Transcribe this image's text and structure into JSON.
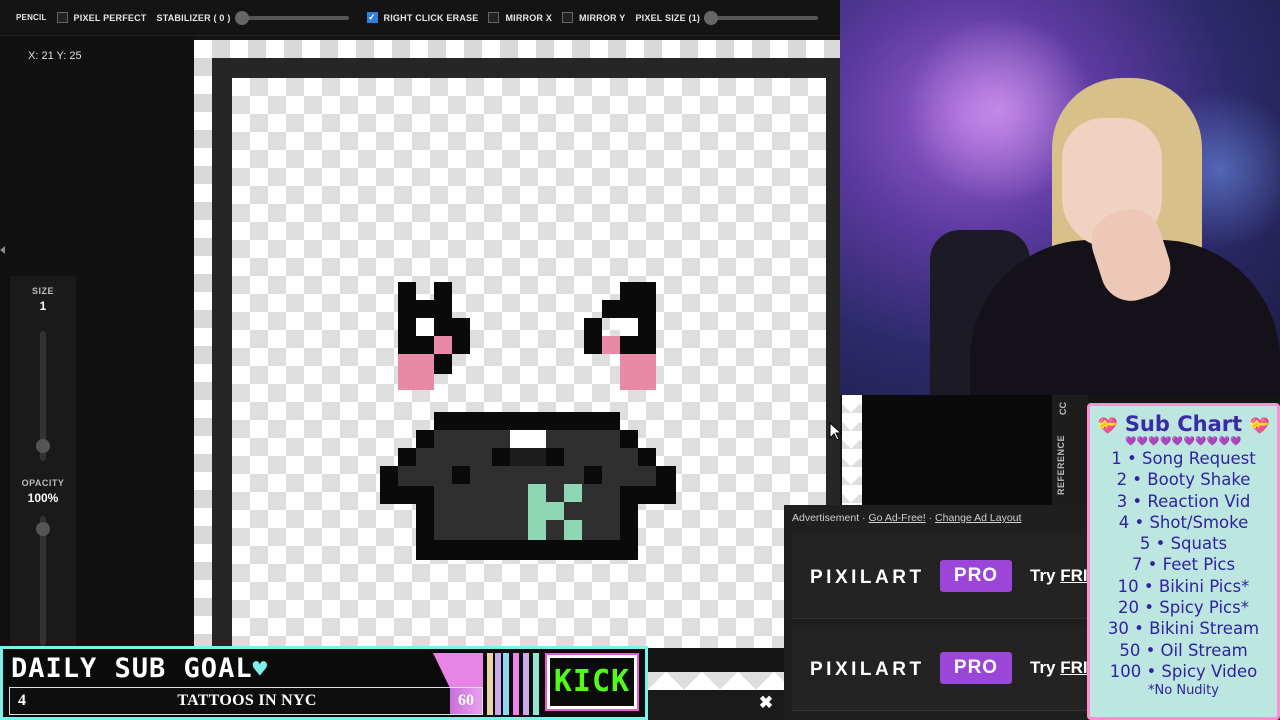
{
  "toolbar": {
    "tool_label": "PENCIL",
    "pixel_perfect": "PIXEL PERFECT",
    "stabilizer": "STABILIZER ( 0 )",
    "right_click_erase": "RIGHT CLICK ERASE",
    "mirror_x": "MIRROR X",
    "mirror_y": "MIRROR Y",
    "pixel_size": "PIXEL SIZE (1)"
  },
  "left_panel": {
    "coords": "X: 21 Y: 25",
    "size_label": "SIZE",
    "size_value": "1",
    "opacity_label": "OPACITY",
    "opacity_value": "100%"
  },
  "side_tabs": {
    "cc": "CC",
    "reference": "REFERENCE"
  },
  "ad": {
    "label": "Advertisement",
    "sep": " · ",
    "go_ad_free": "Go Ad-Free!",
    "change_layout": "Change Ad Layout",
    "brand": "PIXILART",
    "pro": "PRO",
    "try": "Try ",
    "try_highlight": "FRI",
    "close_icon": "✖"
  },
  "sub_chart": {
    "title": "Sub Chart",
    "hearts": "💜💜💜💜💜💜💜💜💜💜",
    "rows": [
      "1 • Song Request",
      "2 • Booty Shake",
      "3 • Reaction Vid",
      "4 • Shot/Smoke",
      "5 • Squats",
      "7 • Feet Pics",
      "10 • Bikini Pics*",
      "20 • Spicy Pics*",
      "30 • Bikini Stream",
      "50 • Oil Stream",
      "100 • Spicy Video"
    ],
    "note": "*No Nudity"
  },
  "goal": {
    "title": "DAILY SUB GOAL",
    "heart": "♥",
    "current": "4",
    "label": "TATTOOS IN NYC",
    "max": "60",
    "progress": 0.067,
    "kick": "KICK"
  },
  "colors": {
    "accent_blue": "#2f7fe0",
    "pro_purple": "#9b45d9",
    "kick_green": "#53fc18",
    "goal_border": "#7df0e8"
  }
}
